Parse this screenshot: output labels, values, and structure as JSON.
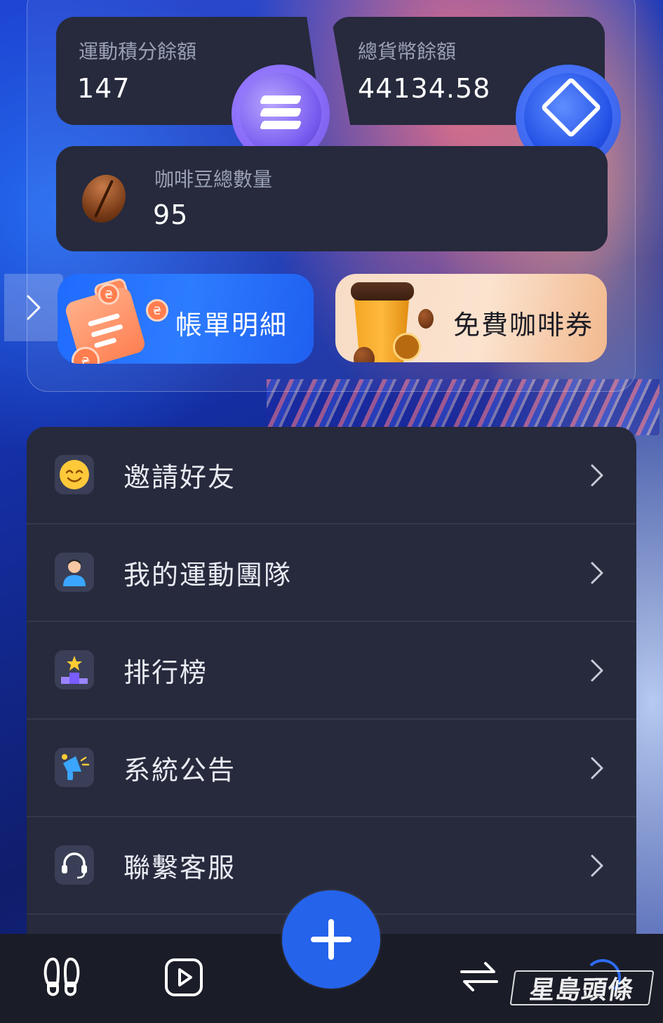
{
  "balances": {
    "sport_points_label": "運動積分餘額",
    "sport_points_value": "147",
    "total_currency_label": "總貨幣餘額",
    "total_currency_value": "44134.58",
    "coffee_beans_label": "咖啡豆總數量",
    "coffee_beans_value": "95"
  },
  "promos": {
    "bill_label": "帳單明細",
    "coffee_label": "免費咖啡券"
  },
  "menu": {
    "items": [
      {
        "label": "邀請好友",
        "icon": "smiley-icon"
      },
      {
        "label": "我的運動團隊",
        "icon": "user-icon"
      },
      {
        "label": "排行榜",
        "icon": "podium-star-icon"
      },
      {
        "label": "系統公告",
        "icon": "megaphone-icon"
      },
      {
        "label": "聯繫客服",
        "icon": "headset-icon"
      }
    ]
  },
  "tabbar": {
    "items": [
      "footprints-icon",
      "play-icon",
      "plus-icon",
      "exchange-icon",
      "profile-icon"
    ]
  },
  "watermark": "星島頭條",
  "colors": {
    "card_bg": "#262a3c",
    "accent_blue": "#2563eb",
    "text_muted": "#9aa0b6"
  }
}
